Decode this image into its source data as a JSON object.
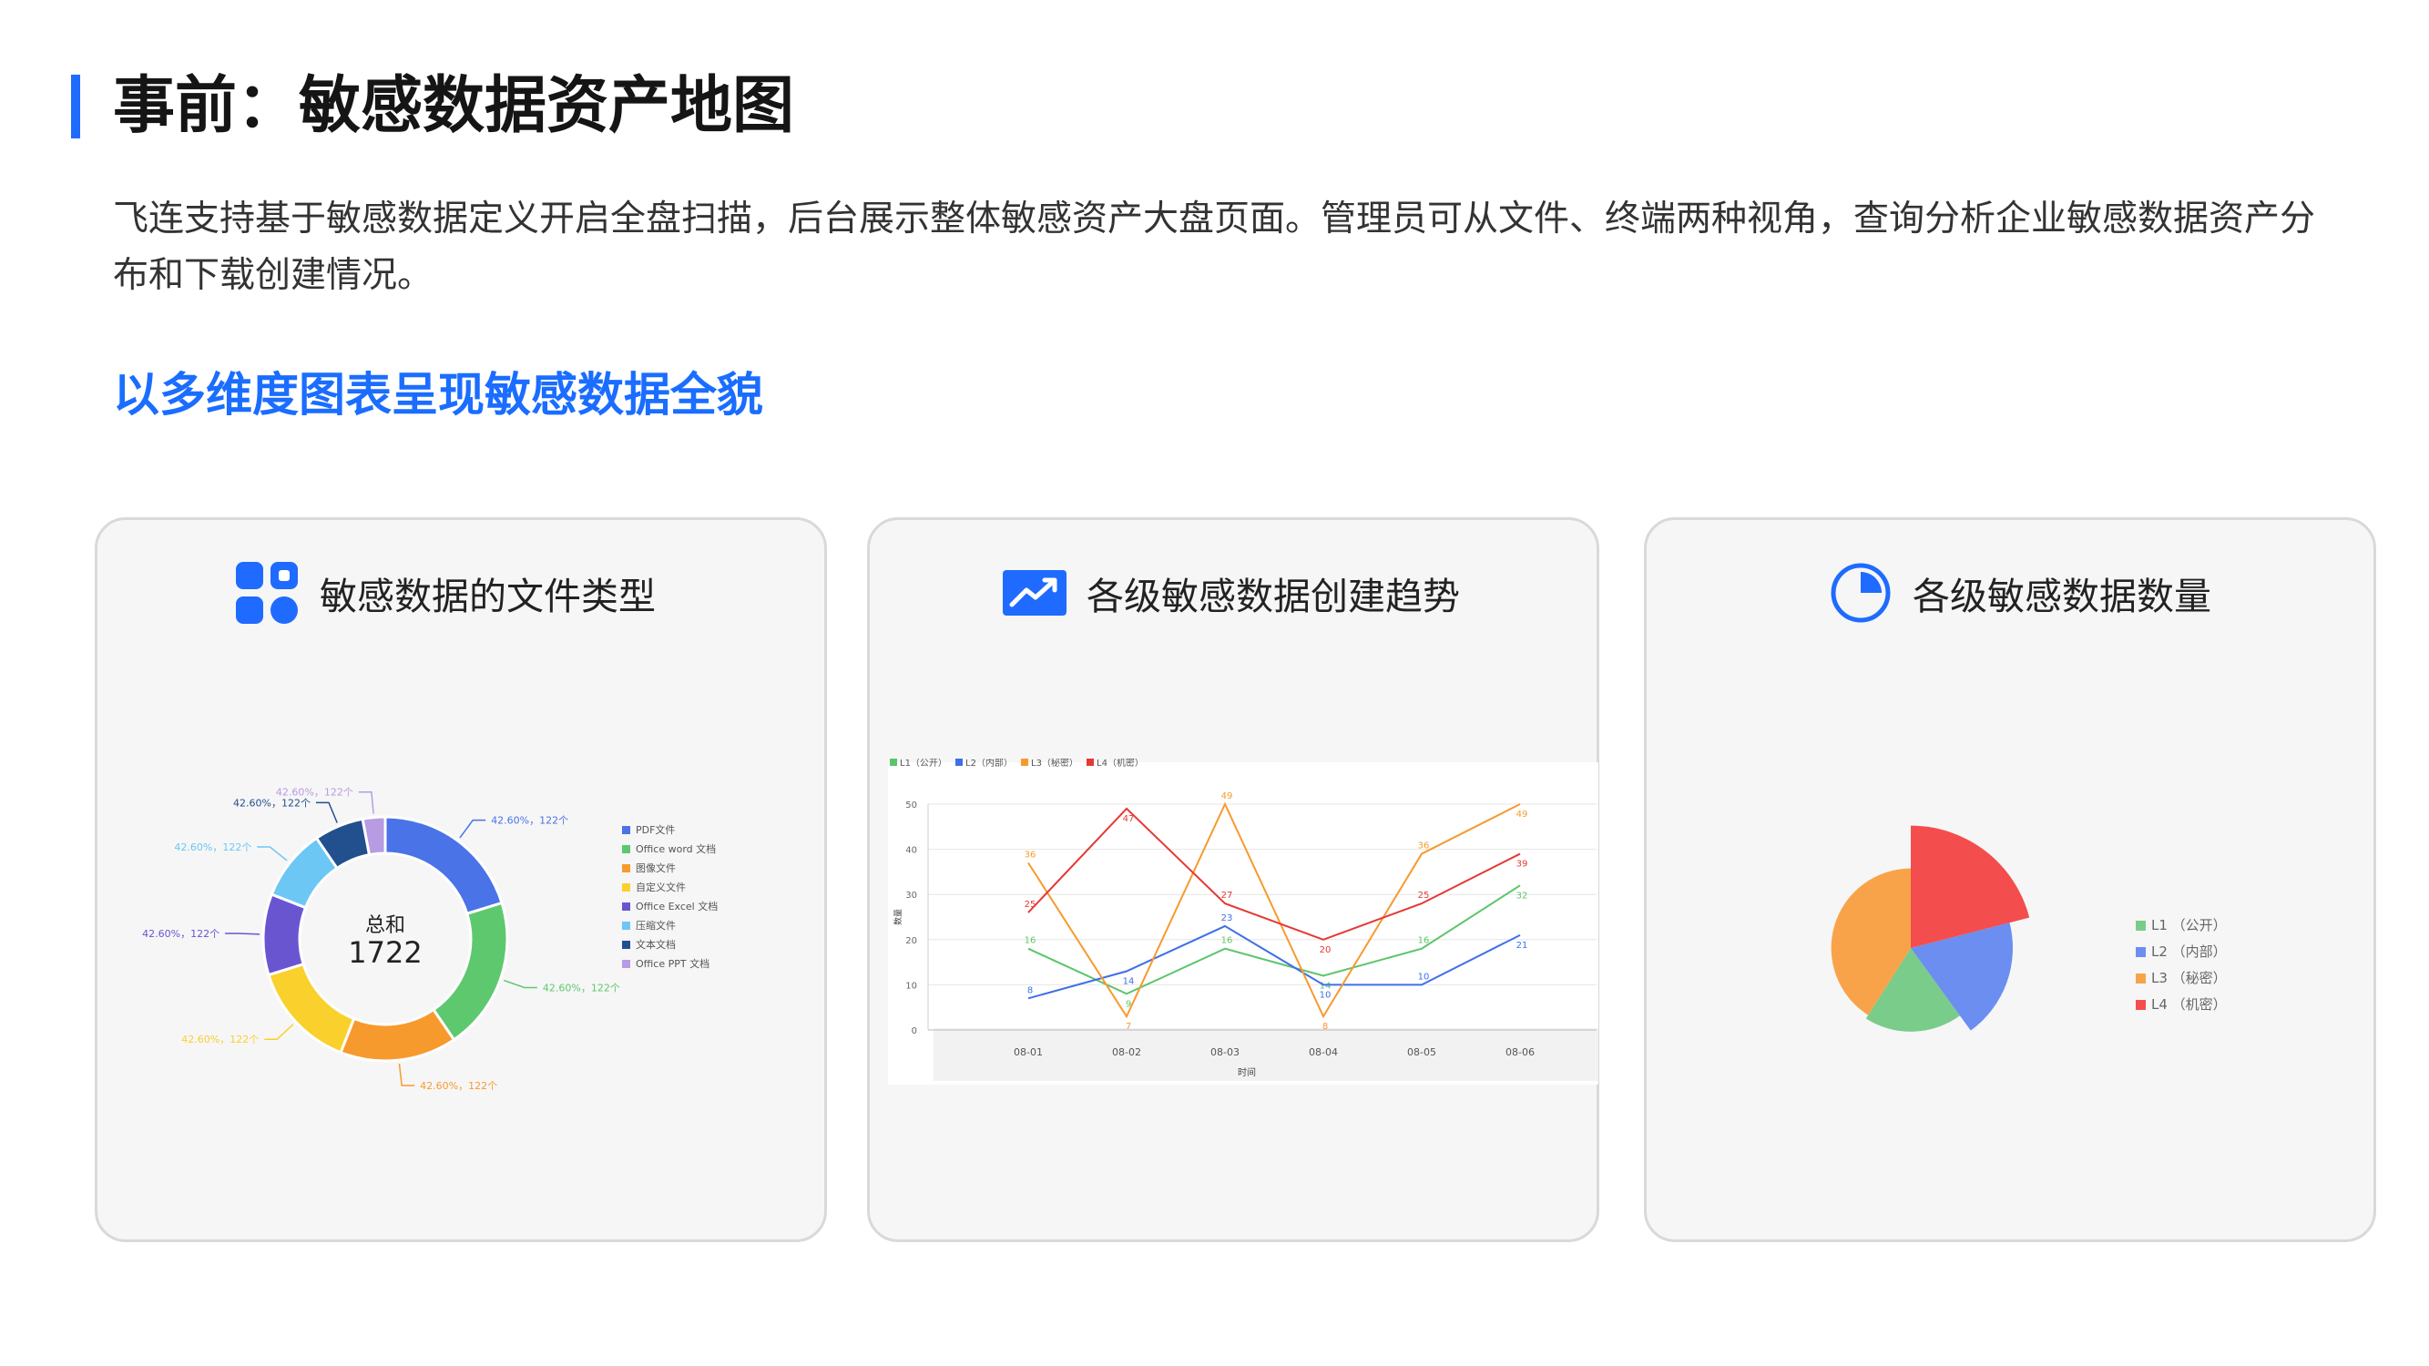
{
  "page": {
    "title": "事前：敏感数据资产地图",
    "intro": "飞连支持基于敏感数据定义开启全盘扫描，后台展示整体敏感资产大盘页面。管理员可从文件、终端两种视角，查询分析企业敏感数据资产分布和下载创建情况。",
    "subtitle": "以多维度图表呈现敏感数据全貌",
    "accent_color": "#1f6bff"
  },
  "cards": [
    {
      "title": "敏感数据的文件类型",
      "icon": "app-grid-icon"
    },
    {
      "title": "各级敏感数据创建趋势",
      "icon": "trend-chart-icon"
    },
    {
      "title": "各级敏感数据数量",
      "icon": "pie-quarter-icon"
    }
  ],
  "chart_data": [
    {
      "type": "pie",
      "subtype": "donut",
      "center_label": "总和",
      "center_value": "1722",
      "slice_label": "42.60%，122个",
      "legend_position": "right",
      "slices": [
        {
          "name": "PDF文件",
          "value": 122,
          "color": "#4a73e8"
        },
        {
          "name": "Office word 文档",
          "value": 122,
          "color": "#5ec86e"
        },
        {
          "name": "图像文件",
          "value": 122,
          "color": "#f79a2e"
        },
        {
          "name": "自定义文件",
          "value": 122,
          "color": "#fad02c"
        },
        {
          "name": "Office Excel 文档",
          "value": 122,
          "color": "#6a55d1"
        },
        {
          "name": "压缩文件",
          "value": 122,
          "color": "#6cc7f5"
        },
        {
          "name": "文本文档",
          "value": 122,
          "color": "#224f8e"
        },
        {
          "name": "Office PPT 文档",
          "value": 122,
          "color": "#b79be3"
        }
      ],
      "slice_fractions": [
        0.17,
        0.17,
        0.13,
        0.12,
        0.09,
        0.08,
        0.055,
        0.025
      ]
    },
    {
      "type": "line",
      "x": [
        "08-01",
        "08-02",
        "08-03",
        "08-04",
        "08-05",
        "08-06"
      ],
      "xlabel": "时间",
      "ylabel": "数量",
      "ylim": [
        0,
        50
      ],
      "yticks": [
        0,
        10,
        20,
        30,
        40,
        50
      ],
      "grid": true,
      "legend_position": "top-left",
      "series": [
        {
          "name": "L1（公开）",
          "color": "#5cc56a",
          "values": [
            18,
            8,
            18,
            12,
            18,
            32
          ],
          "labels": [
            16,
            9,
            16,
            14,
            16,
            32
          ]
        },
        {
          "name": "L2（内部）",
          "color": "#3e6fe8",
          "values": [
            7,
            13,
            23,
            10,
            10,
            21
          ],
          "labels": [
            8,
            14,
            23,
            10,
            10,
            21
          ]
        },
        {
          "name": "L3（秘密）",
          "color": "#f79a2e",
          "values": [
            37,
            3,
            50,
            3,
            39,
            50
          ],
          "labels": [
            36,
            7,
            49,
            8,
            36,
            49
          ]
        },
        {
          "name": "L4（机密）",
          "color": "#e53935",
          "values": [
            26,
            49,
            28,
            20,
            28,
            39
          ],
          "labels": [
            25,
            47,
            27,
            20,
            25,
            39
          ]
        }
      ]
    },
    {
      "type": "pie",
      "subtype": "rose",
      "legend_position": "right",
      "slices": [
        {
          "name": "L1 （公开）",
          "color": "#7acc8b",
          "radius_ratio": 0.82
        },
        {
          "name": "L2 （内部）",
          "color": "#6b8ef0",
          "radius_ratio": 1.0
        },
        {
          "name": "L3 （秘密）",
          "color": "#f8a349",
          "radius_ratio": 0.78
        },
        {
          "name": "L4 （机密）",
          "color": "#f44d4d",
          "radius_ratio": 1.2
        }
      ]
    }
  ]
}
